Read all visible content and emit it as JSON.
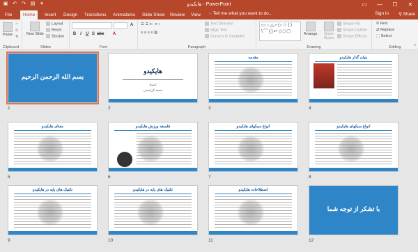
{
  "window": {
    "title": "هایکیدو - PowerPoint",
    "sign_in": "Sign in",
    "share": "Share",
    "minimize": "—",
    "maximize": "☐",
    "close": "✕",
    "ribbon_options": "▭"
  },
  "qat": {
    "save": "▣",
    "undo": "↶",
    "redo": "↷",
    "start": "▤",
    "more": "▾"
  },
  "tabs": [
    "File",
    "Home",
    "Insert",
    "Design",
    "Transitions",
    "Animations",
    "Slide Show",
    "Review",
    "View"
  ],
  "tell_me": "Tell me what you want to do...",
  "ribbon": {
    "clipboard": {
      "label": "Clipboard",
      "paste": "Paste"
    },
    "slides": {
      "label": "Slides",
      "new_slide": "New Slide",
      "layout": "Layout",
      "reset": "Reset",
      "section": "Section"
    },
    "font": {
      "label": "Font"
    },
    "paragraph": {
      "label": "Paragraph",
      "text_direction": "Text Direction",
      "align_text": "Align Text",
      "convert": "Convert to SmartArt"
    },
    "drawing": {
      "label": "Drawing",
      "arrange": "Arrange",
      "quick_styles": "Quick Styles",
      "shape_fill": "Shape Fill",
      "shape_outline": "Shape Outline",
      "shape_effects": "Shape Effects",
      "shapes_gallery": "▭○△⌐▷☆⟨⟩\\⌒{}↵◇□⬡"
    },
    "editing": {
      "label": "Editing",
      "find": "Find",
      "replace": "Replace",
      "select": "Select"
    }
  },
  "slides": [
    {
      "num": "1",
      "title": "بسم الله الرحمن الرحیم"
    },
    {
      "num": "2",
      "title": "هایکیدو",
      "sub1": "استاد:",
      "sub2": "محمد کرابیسی"
    },
    {
      "num": "3",
      "title": "مقدمه"
    },
    {
      "num": "4",
      "title": "بنیان گذار هایکیدو"
    },
    {
      "num": "5",
      "title": "معنای هایکیدو"
    },
    {
      "num": "6",
      "title": "فلسفه ورزش هایکیدو"
    },
    {
      "num": "7",
      "title": "انواع سبکهای هایکیدو"
    },
    {
      "num": "8",
      "title": "انواع سبکهای هایکیدو"
    },
    {
      "num": "9",
      "title": "تکنیک های پایه در هایکیدو"
    },
    {
      "num": "10",
      "title": "تکنیک های پایه در هایکیدو"
    },
    {
      "num": "11",
      "title": "اصطلاحات هایکیدو"
    },
    {
      "num": "12",
      "title": "با تشکر از توجه شما"
    }
  ],
  "colors": {
    "accent": "#b7472a",
    "slide_blue": "#2e86c8",
    "selection": "#e1734f"
  }
}
